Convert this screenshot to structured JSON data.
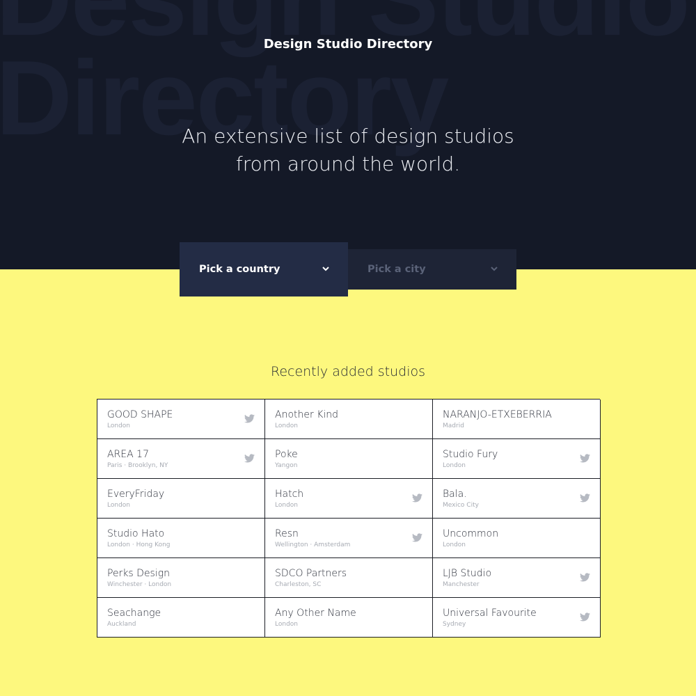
{
  "header": {
    "watermark_line1": "Design Studio",
    "watermark_line2": "Directory",
    "title": "Design Studio Directory",
    "tagline": "An extensive list of design studios from around the world."
  },
  "filters": {
    "country_label": "Pick a country",
    "city_label": "Pick a city"
  },
  "recent": {
    "title": "Recently added studios",
    "studios": [
      {
        "name": "GOOD SHAPE",
        "location": "London",
        "twitter": true
      },
      {
        "name": "Another Kind",
        "location": "London",
        "twitter": false
      },
      {
        "name": "NARANJO-ETXEBERRIA",
        "location": "Madrid",
        "twitter": false
      },
      {
        "name": "AREA 17",
        "location": "Paris · Brooklyn, NY",
        "twitter": true
      },
      {
        "name": "Poke",
        "location": "Yangon",
        "twitter": false
      },
      {
        "name": "Studio Fury",
        "location": "London",
        "twitter": true
      },
      {
        "name": "EveryFriday",
        "location": "London",
        "twitter": false
      },
      {
        "name": "Hatch",
        "location": "London",
        "twitter": true
      },
      {
        "name": "Bala.",
        "location": "Mexico City",
        "twitter": true
      },
      {
        "name": "Studio Hato",
        "location": "London · Hong Kong",
        "twitter": false
      },
      {
        "name": "Resn",
        "location": "Wellington · Amsterdam",
        "twitter": true
      },
      {
        "name": "Uncommon",
        "location": "London",
        "twitter": false
      },
      {
        "name": "Perks Design",
        "location": "Winchester · London",
        "twitter": false
      },
      {
        "name": "SDCO Partners",
        "location": "Charleston, SC",
        "twitter": false
      },
      {
        "name": "LJB Studio",
        "location": "Manchester",
        "twitter": true
      },
      {
        "name": "Seachange",
        "location": "Auckland",
        "twitter": false
      },
      {
        "name": "Any Other Name",
        "location": "London",
        "twitter": false
      },
      {
        "name": "Universal Favourite",
        "location": "Sydney",
        "twitter": true
      }
    ]
  },
  "colors": {
    "hero_bg": "#141927",
    "page_bg": "#fdf87e",
    "select_active": "#232c45",
    "select_inactive": "#1e2436",
    "icon": "#b6bac2"
  },
  "icons": {
    "dropdown": "chevron-down-icon",
    "social": "twitter-icon"
  }
}
